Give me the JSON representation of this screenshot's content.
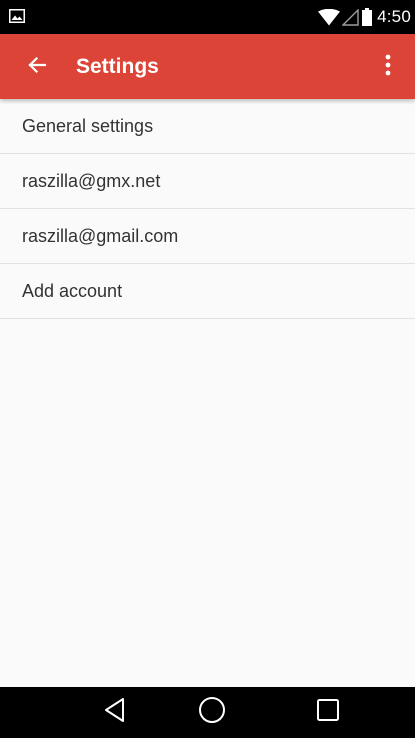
{
  "status_bar": {
    "time": "4:50",
    "icons": [
      "image-notification-icon",
      "wifi-icon",
      "signal-icon",
      "battery-icon"
    ]
  },
  "app_bar": {
    "title": "Settings",
    "background_color": "#db4437",
    "icons": [
      "arrow-back-icon",
      "more-vert-icon"
    ]
  },
  "settings_list": {
    "items": [
      {
        "label": "General settings"
      },
      {
        "label": "raszilla@gmx.net"
      },
      {
        "label": "raszilla@gmail.com"
      },
      {
        "label": "Add account"
      }
    ]
  },
  "nav_bar": {
    "icons": [
      "nav-back-icon",
      "nav-home-icon",
      "nav-recents-icon"
    ]
  }
}
